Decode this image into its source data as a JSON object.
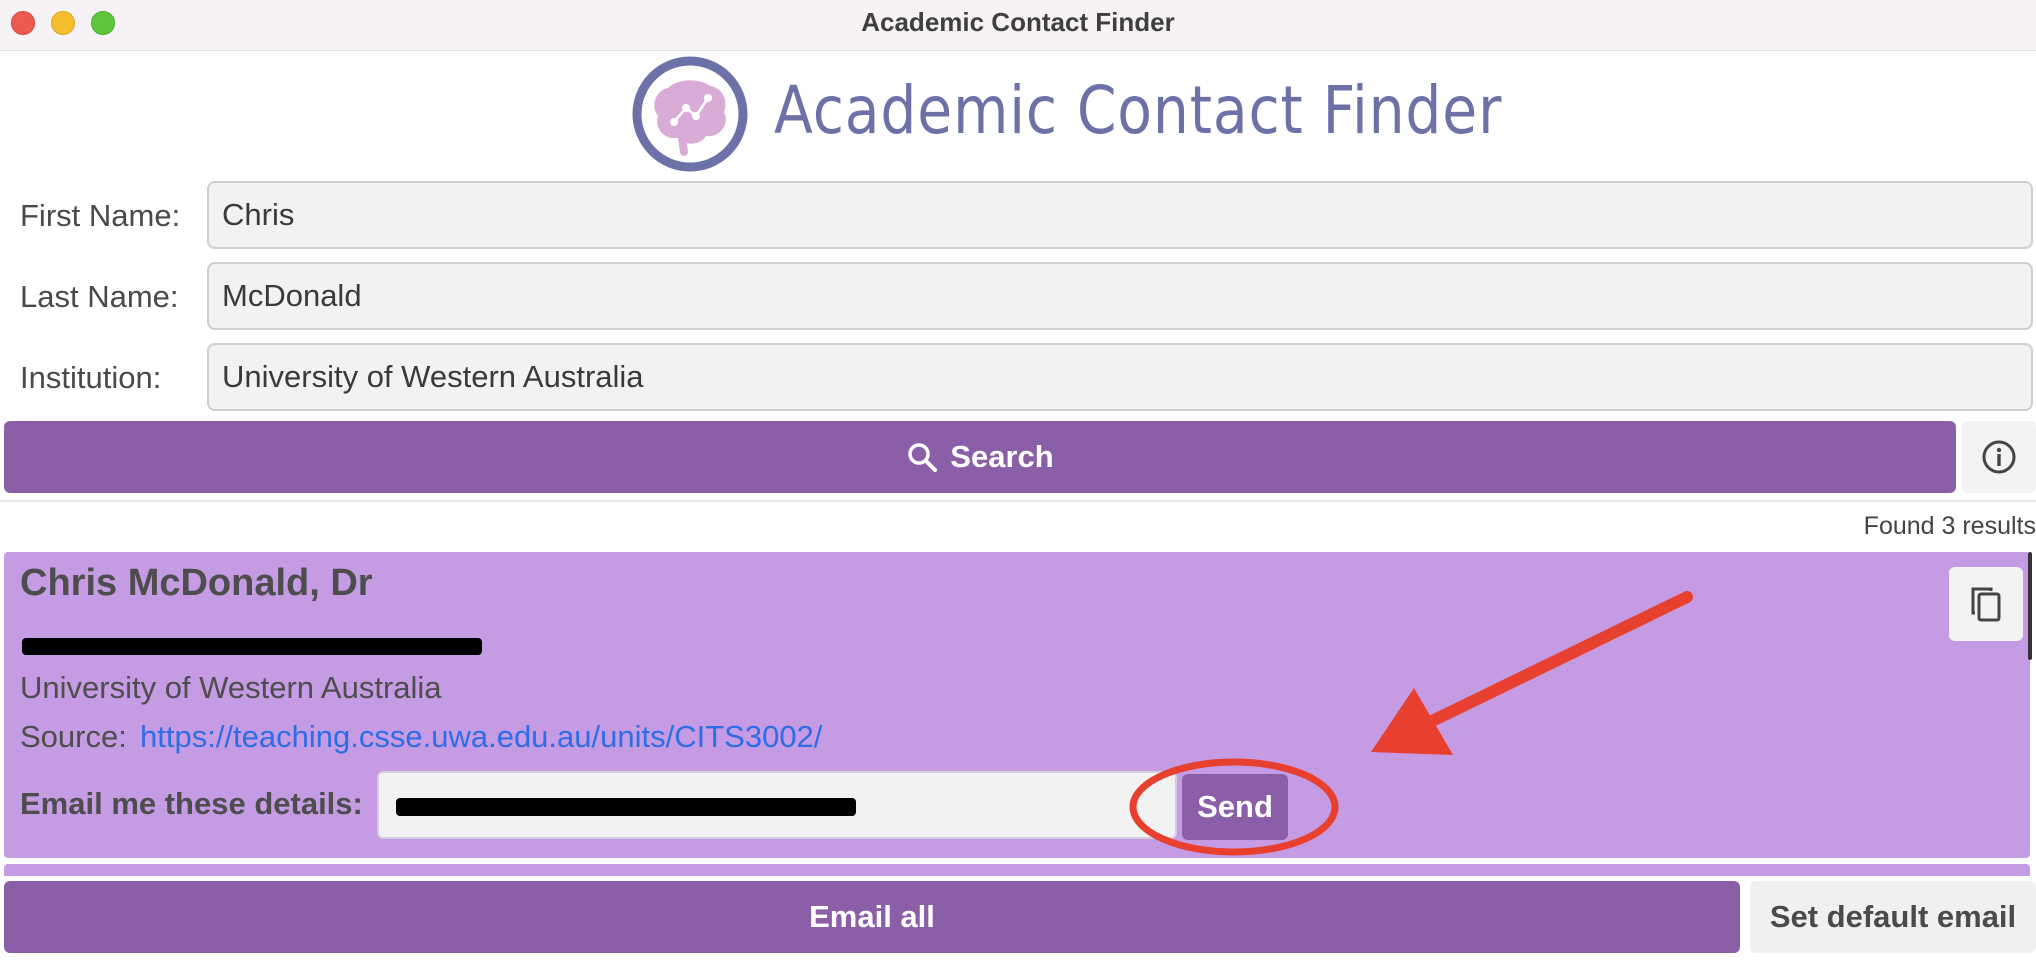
{
  "window": {
    "title": "Academic Contact Finder"
  },
  "logo": {
    "text": "Academic Contact Finder",
    "icon": "brain-icon"
  },
  "form": {
    "first_name_label": "First Name:",
    "first_name_value": "Chris",
    "last_name_label": "Last Name:",
    "last_name_value": "McDonald",
    "institution_label": "Institution:",
    "institution_value": "University of Western Australia"
  },
  "search": {
    "label": "Search",
    "icon": "search-icon",
    "info_icon": "info-icon"
  },
  "results": {
    "count_text": "Found 3 results",
    "items": [
      {
        "name": "Chris McDonald, Dr",
        "institution": "University of Western Australia",
        "source_label": "Source:",
        "source_url": "https://teaching.csse.uwa.edu.au/units/CITS3002/",
        "email_label": "Email me these details:",
        "send_label": "Send",
        "copy_icon": "copy-icon"
      }
    ]
  },
  "footer": {
    "email_all_label": "Email all",
    "set_default_label": "Set default email"
  },
  "colors": {
    "accent": "#8a5fa8",
    "card": "#c59be4",
    "link": "#2e6de6",
    "annotation": "#e8402e"
  }
}
